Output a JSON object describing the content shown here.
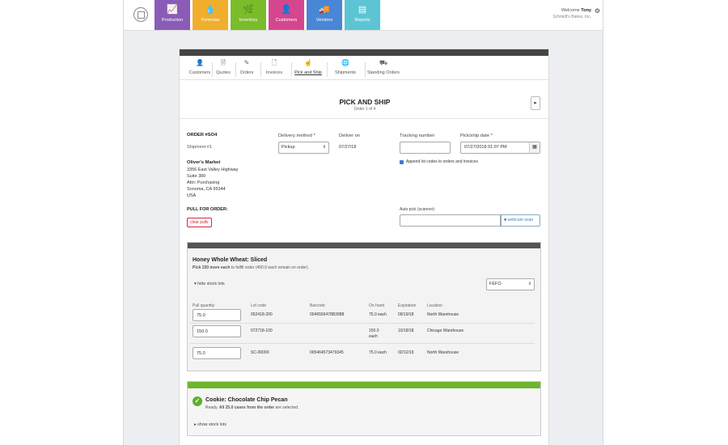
{
  "nav": {
    "tiles": [
      {
        "label": "Production",
        "icon": "chart-line-icon",
        "glyph": "📈",
        "color": "#8a5cb8"
      },
      {
        "label": "Formulas",
        "icon": "flask-drop-icon",
        "glyph": "💧",
        "color": "#f0ae2c"
      },
      {
        "label": "Inventory",
        "icon": "leaf-icon",
        "glyph": "🌿",
        "color": "#7bbc2a"
      },
      {
        "label": "Customers",
        "icon": "user-icon",
        "glyph": "👤",
        "color": "#d4478f"
      },
      {
        "label": "Vendors",
        "icon": "truck-icon",
        "glyph": "🚚",
        "color": "#4a86d6"
      },
      {
        "label": "Reports",
        "icon": "report-icon",
        "glyph": "▤",
        "color": "#5dc4d4"
      }
    ]
  },
  "user": {
    "welcome": "Welcome",
    "name": "Tony",
    "company": "Schmidt's Bakes, Inc."
  },
  "tabs": [
    {
      "label": "Customers",
      "glyph": "👤"
    },
    {
      "label": "Quotes",
      "glyph": "🗎"
    },
    {
      "label": "Orders",
      "glyph": "✎"
    },
    {
      "label": "Invoices",
      "glyph": "🗋"
    },
    {
      "label": "Pick and Ship",
      "glyph": "☝"
    },
    {
      "label": "Shipments",
      "glyph": "🌐"
    },
    {
      "label": "Standing Orders",
      "glyph": "⛟"
    }
  ],
  "page": {
    "title": "PICK AND SHIP",
    "subtitle": "Order 1 of 4",
    "next_icon": "▸"
  },
  "order": {
    "number": "ORDER #SO4",
    "shipment": "Shipment #1",
    "customer_name": "Oliver's Market",
    "address_lines": [
      "3356 East Valley Highway",
      "Suite 300",
      "Attn: Purchasing",
      "Sonoma, CA 95344",
      "USA"
    ],
    "pull_label": "PULL FOR ORDER:",
    "clear_pulls": "clear pulls"
  },
  "fields": {
    "delivery_method_label": "Delivery method *",
    "delivery_method_value": "Pickup",
    "deliver_on_label": "Deliver on",
    "deliver_on_value": "07/27/18",
    "tracking_label": "Tracking number",
    "tracking_value": "",
    "pickship_label": "Pick/ship date *",
    "pickship_value": "07/27/2018 01:07 PM",
    "append_lot_codes": "Append lot codes to orders and invoices",
    "autopick_label": "Auto pick (scanner)",
    "autopick_value": "",
    "webcam_scan": "webcam scan"
  },
  "product1": {
    "name": "Honey Whole Wheat: Sliced",
    "pick_bold": "Pick 150 more each",
    "pick_rest": " to fulfill order (450.0 each remain on order).",
    "toggle": "▾ hide stock lots",
    "sort": "FEFO",
    "headers": [
      "Pull quantity",
      "Lot code",
      "Barcode",
      "On hand",
      "Expiration",
      "Location"
    ],
    "rows": [
      {
        "qty": "75.0",
        "lot": "052418-200",
        "barcode": "0046556478B3988",
        "onhand": "75.0 each",
        "exp": "09/19/18",
        "loc": "North Warehouse"
      },
      {
        "qty": "150.0",
        "lot": "072718-100",
        "barcode": "",
        "onhand": "150.0",
        "onhand2": "each",
        "exp": "10/18/18",
        "loc": "Chicago Warehouse"
      },
      {
        "qty": "75.0",
        "lot": "SC-00000",
        "barcode": "005464573479345",
        "onhand": "75.0 each",
        "exp": "02/12/19",
        "loc": "North Warehouse"
      }
    ],
    "header_color": "#555555"
  },
  "product2": {
    "name": "Cookie: Chocolate Chip Pecan",
    "ready_pre": "Ready. ",
    "ready_bold": "All 25.0 cases from the order",
    "ready_post": " are selected.",
    "toggle": "▸ show stock lots",
    "header_color": "#6fb52e"
  }
}
